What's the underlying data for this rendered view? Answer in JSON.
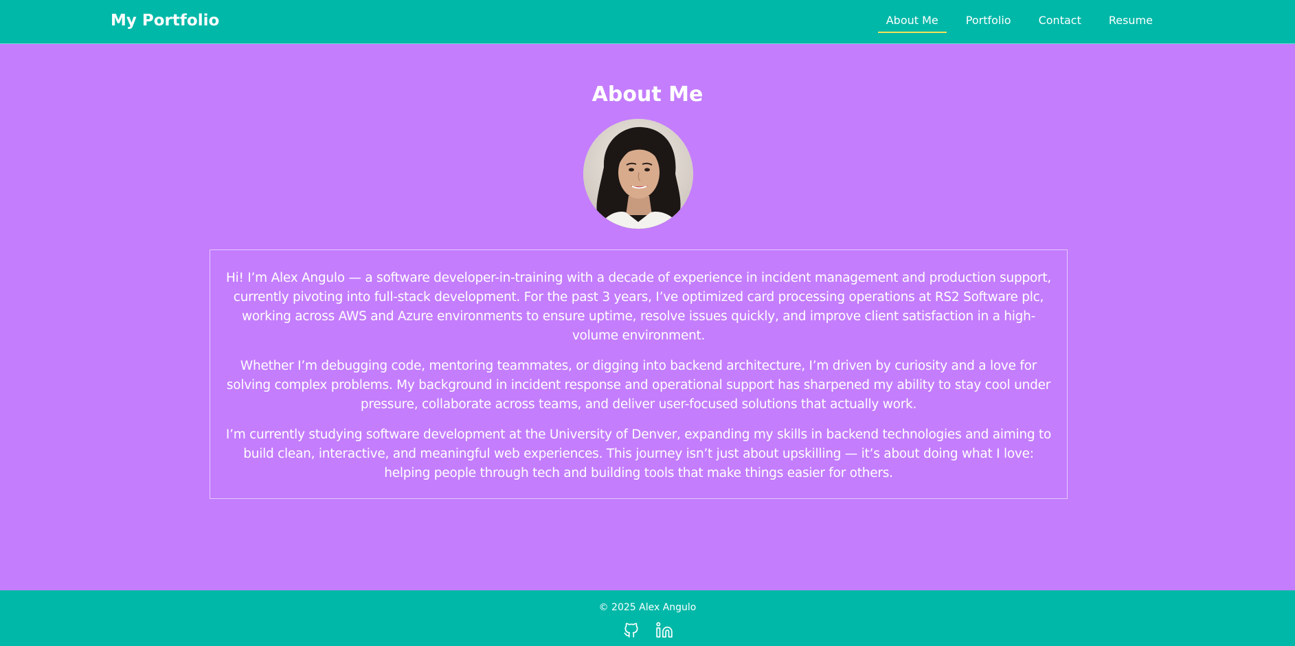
{
  "header": {
    "brand": "My Portfolio",
    "nav": [
      {
        "label": "About Me",
        "active": true
      },
      {
        "label": "Portfolio",
        "active": false
      },
      {
        "label": "Contact",
        "active": false
      },
      {
        "label": "Resume",
        "active": false
      }
    ]
  },
  "main": {
    "title": "About Me",
    "bio": [
      "Hi! I’m Alex Angulo — a software developer-in-training with a decade of experience in incident management and production support, currently pivoting into full-stack development. For the past 3 years, I’ve optimized card processing operations at RS2 Software plc, working across AWS and Azure environments to ensure uptime, resolve issues quickly, and improve client satisfaction in a high-volume environment.",
      "Whether I’m debugging code, mentoring teammates, or digging into backend architecture, I’m driven by curiosity and a love for solving complex problems. My background in incident response and operational support has sharpened my ability to stay cool under pressure, collaborate across teams, and deliver user-focused solutions that actually work.",
      "I’m currently studying software development at the University of Denver, expanding my skills in backend technologies and aiming to build clean, interactive, and meaningful web experiences. This journey isn’t just about upskilling — it’s about doing what I love: helping people through tech and building tools that make things easier for others."
    ]
  },
  "footer": {
    "copyright": "© 2025 Alex Angulo",
    "social": [
      {
        "icon": "github-icon"
      },
      {
        "icon": "linkedin-icon"
      }
    ]
  },
  "colors": {
    "page_background": "#c47dfd",
    "header_background": "#00b8a8",
    "active_underline": "#f5e15a"
  }
}
